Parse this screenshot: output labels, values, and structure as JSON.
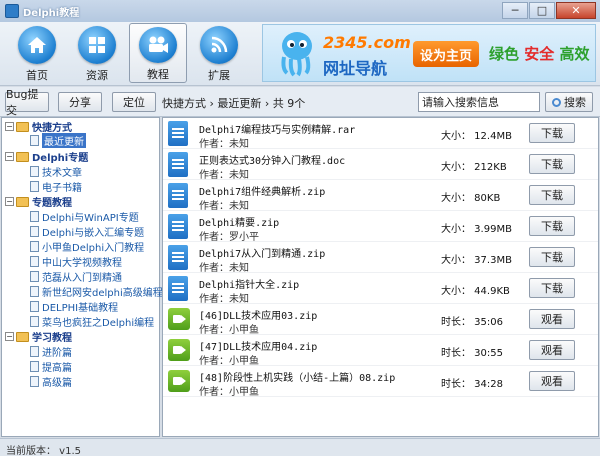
{
  "window": {
    "title": "Delphi教程",
    "min": "─",
    "max": "□",
    "close": "✕"
  },
  "toolbar": {
    "items": [
      {
        "label": "首页",
        "icon": "home-icon"
      },
      {
        "label": "资源",
        "icon": "grid-icon"
      },
      {
        "label": "教程",
        "icon": "camera-icon",
        "active": true
      },
      {
        "label": "扩展",
        "icon": "wifi-icon"
      }
    ],
    "banner": {
      "logo": "2345.com",
      "subtitle": "网址导航",
      "button": "设为主页",
      "tag1": "绿色",
      "tag2": "安全",
      "tag3": "高效"
    }
  },
  "actionbar": {
    "bug_label": "Bug提交",
    "share_label": "分享",
    "locate_label": "定位",
    "breadcrumb": "快捷方式 › 最近更新 › 共 9个",
    "search_placeholder": "请输入搜索信息",
    "search_label": "搜索"
  },
  "tree": {
    "nodes": [
      {
        "label": "快捷方式",
        "type": "category"
      },
      {
        "label": "最近更新",
        "type": "item",
        "selected": true
      },
      {
        "label": "Delphi专题",
        "type": "category"
      },
      {
        "label": "技术文章",
        "type": "item"
      },
      {
        "label": "电子书籍",
        "type": "item"
      },
      {
        "label": "专题教程",
        "type": "category"
      },
      {
        "label": "Delphi与WinAPI专题",
        "type": "item"
      },
      {
        "label": "Delphi与嵌入汇编专题",
        "type": "item"
      },
      {
        "label": "小甲鱼Delphi入门教程",
        "type": "item"
      },
      {
        "label": "中山大学视频教程",
        "type": "item"
      },
      {
        "label": "范磊从入门到精通",
        "type": "item"
      },
      {
        "label": "新世纪网安delphi高级编程",
        "type": "item"
      },
      {
        "label": "DELPHI基础教程",
        "type": "item"
      },
      {
        "label": "菜鸟也疯狂之Delphi编程",
        "type": "item"
      },
      {
        "label": "学习教程",
        "type": "category"
      },
      {
        "label": "进阶篇",
        "type": "item"
      },
      {
        "label": "提高篇",
        "type": "item"
      },
      {
        "label": "高级篇",
        "type": "item"
      }
    ]
  },
  "list": {
    "rows": [
      {
        "kind": "file",
        "title": "Delphi7编程技巧与实例精解.rar",
        "author": "作者：未知",
        "size": "大小：  12.4MB",
        "action": "下载"
      },
      {
        "kind": "file",
        "title": "正则表达式30分钟入门教程.doc",
        "author": "作者：未知",
        "size": "大小：  212KB",
        "action": "下载"
      },
      {
        "kind": "file",
        "title": "Delphi7组件经典解析.zip",
        "author": "作者：未知",
        "size": "大小：  80KB",
        "action": "下载"
      },
      {
        "kind": "file",
        "title": "Delphi精要.zip",
        "author": "作者：罗小平",
        "size": "大小：  3.99MB",
        "action": "下载"
      },
      {
        "kind": "file",
        "title": "Delphi7从入门到精通.zip",
        "author": "作者：未知",
        "size": "大小：  37.3MB",
        "action": "下载"
      },
      {
        "kind": "file",
        "title": "Delphi指针大全.zip",
        "author": "作者：未知",
        "size": "大小：  44.9KB",
        "action": "下载"
      },
      {
        "kind": "video",
        "title": "[46]DLL技术应用03.zip",
        "author": "作者：小甲鱼",
        "size": "时长：  35:06",
        "action": "观看"
      },
      {
        "kind": "video",
        "title": "[47]DLL技术应用04.zip",
        "author": "作者：小甲鱼",
        "size": "时长：  30:55",
        "action": "观看"
      },
      {
        "kind": "video",
        "title": "[48]阶段性上机实践（小结-上篇）08.zip",
        "author": "作者：小甲鱼",
        "size": "时长：  34:28",
        "action": "观看"
      }
    ]
  },
  "status": {
    "text": "当前版本： v1.5"
  }
}
